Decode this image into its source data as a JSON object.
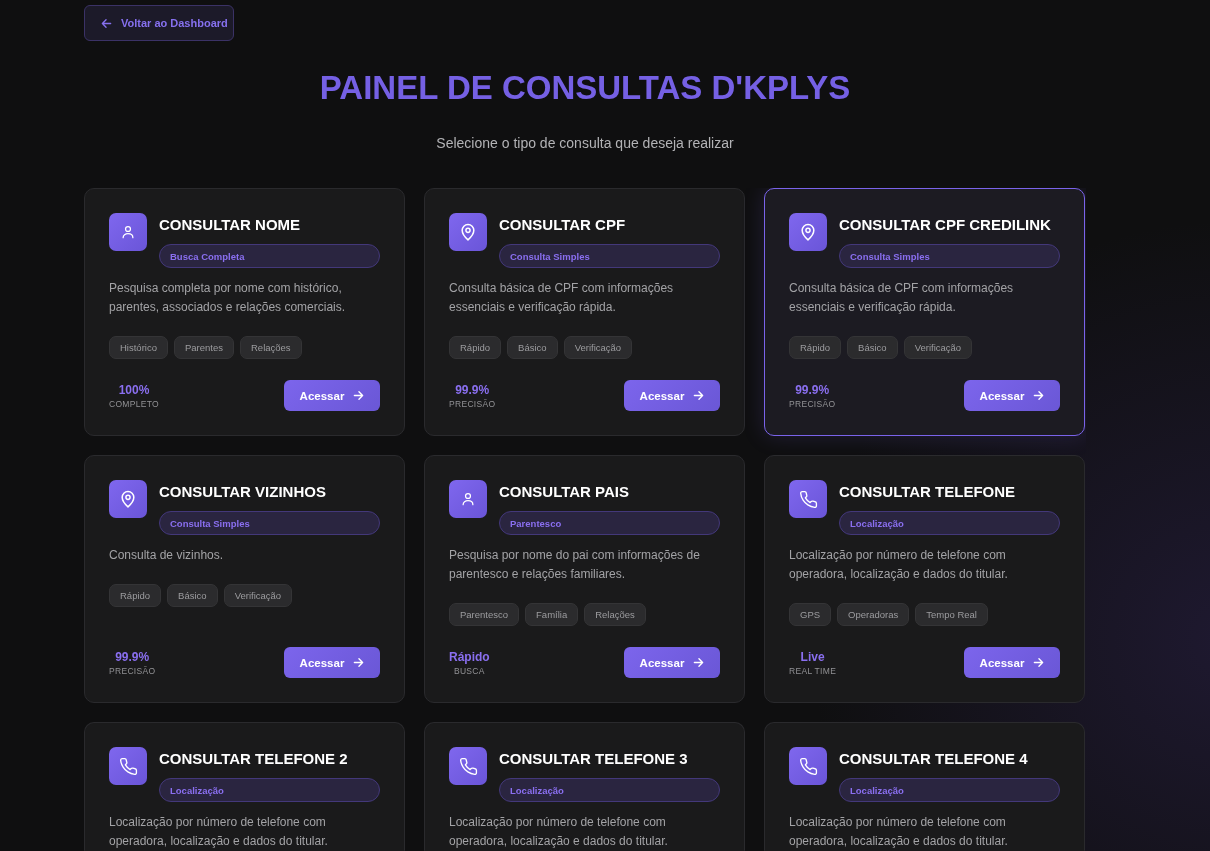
{
  "back_button": {
    "label": "Voltar ao Dashboard"
  },
  "header": {
    "title": "PAINEL DE CONSULTAS D'KPLYS",
    "subtitle": "Selecione o tipo de consulta que deseja realizar"
  },
  "cards": [
    {
      "kind": "person",
      "title": "CONSULTAR NOME",
      "badge": "Busca Completa",
      "description": "Pesquisa completa por nome com histórico, parentes, associados e relações comerciais.",
      "tags": [
        "Histórico",
        "Parentes",
        "Relações"
      ],
      "stat": {
        "value": "100%",
        "label": "COMPLETO"
      },
      "button": "Acessar",
      "selected": false
    },
    {
      "kind": "location",
      "title": "CONSULTAR CPF",
      "badge": "Consulta Simples",
      "description": "Consulta básica de CPF com informações essenciais e verificação rápida.",
      "tags": [
        "Rápido",
        "Básico",
        "Verificação"
      ],
      "stat": {
        "value": "99.9%",
        "label": "PRECISÃO"
      },
      "button": "Acessar",
      "selected": false
    },
    {
      "kind": "location",
      "title": "CONSULTAR CPF CREDILINK",
      "badge": "Consulta Simples",
      "description": "Consulta básica de CPF com informações essenciais e verificação rápida.",
      "tags": [
        "Rápido",
        "Básico",
        "Verificação"
      ],
      "stat": {
        "value": "99.9%",
        "label": "PRECISÃO"
      },
      "button": "Acessar",
      "selected": true
    },
    {
      "kind": "location",
      "title": "CONSULTAR VIZINHOS",
      "badge": "Consulta Simples",
      "description": "Consulta de vizinhos.",
      "tags": [
        "Rápido",
        "Básico",
        "Verificação"
      ],
      "stat": {
        "value": "99.9%",
        "label": "PRECISÃO"
      },
      "button": "Acessar",
      "selected": false
    },
    {
      "kind": "person",
      "title": "CONSULTAR PAIS",
      "badge": "Parentesco",
      "description": "Pesquisa por nome do pai com informações de parentesco e relações familiares.",
      "tags": [
        "Parentesco",
        "Família",
        "Relações"
      ],
      "stat": {
        "value": "Rápido",
        "label": "BUSCA"
      },
      "button": "Acessar",
      "selected": false
    },
    {
      "kind": "phone",
      "title": "CONSULTAR TELEFONE",
      "badge": "Localização",
      "description": "Localização por número de telefone com operadora, localização e dados do titular.",
      "tags": [
        "GPS",
        "Operadoras",
        "Tempo Real"
      ],
      "stat": {
        "value": "Live",
        "label": "REAL TIME"
      },
      "button": "Acessar",
      "selected": false
    },
    {
      "kind": "phone",
      "title": "CONSULTAR TELEFONE 2",
      "badge": "Localização",
      "description": "Localização por número de telefone com operadora, localização e dados do titular.",
      "selected": false
    },
    {
      "kind": "phone",
      "title": "CONSULTAR TELEFONE 3",
      "badge": "Localização",
      "description": "Localização por número de telefone com operadora, localização e dados do titular.",
      "selected": false
    },
    {
      "kind": "phone",
      "title": "CONSULTAR TELEFONE 4",
      "badge": "Localização",
      "description": "Localização por número de telefone com operadora, localização e dados do titular.",
      "selected": false
    }
  ]
}
